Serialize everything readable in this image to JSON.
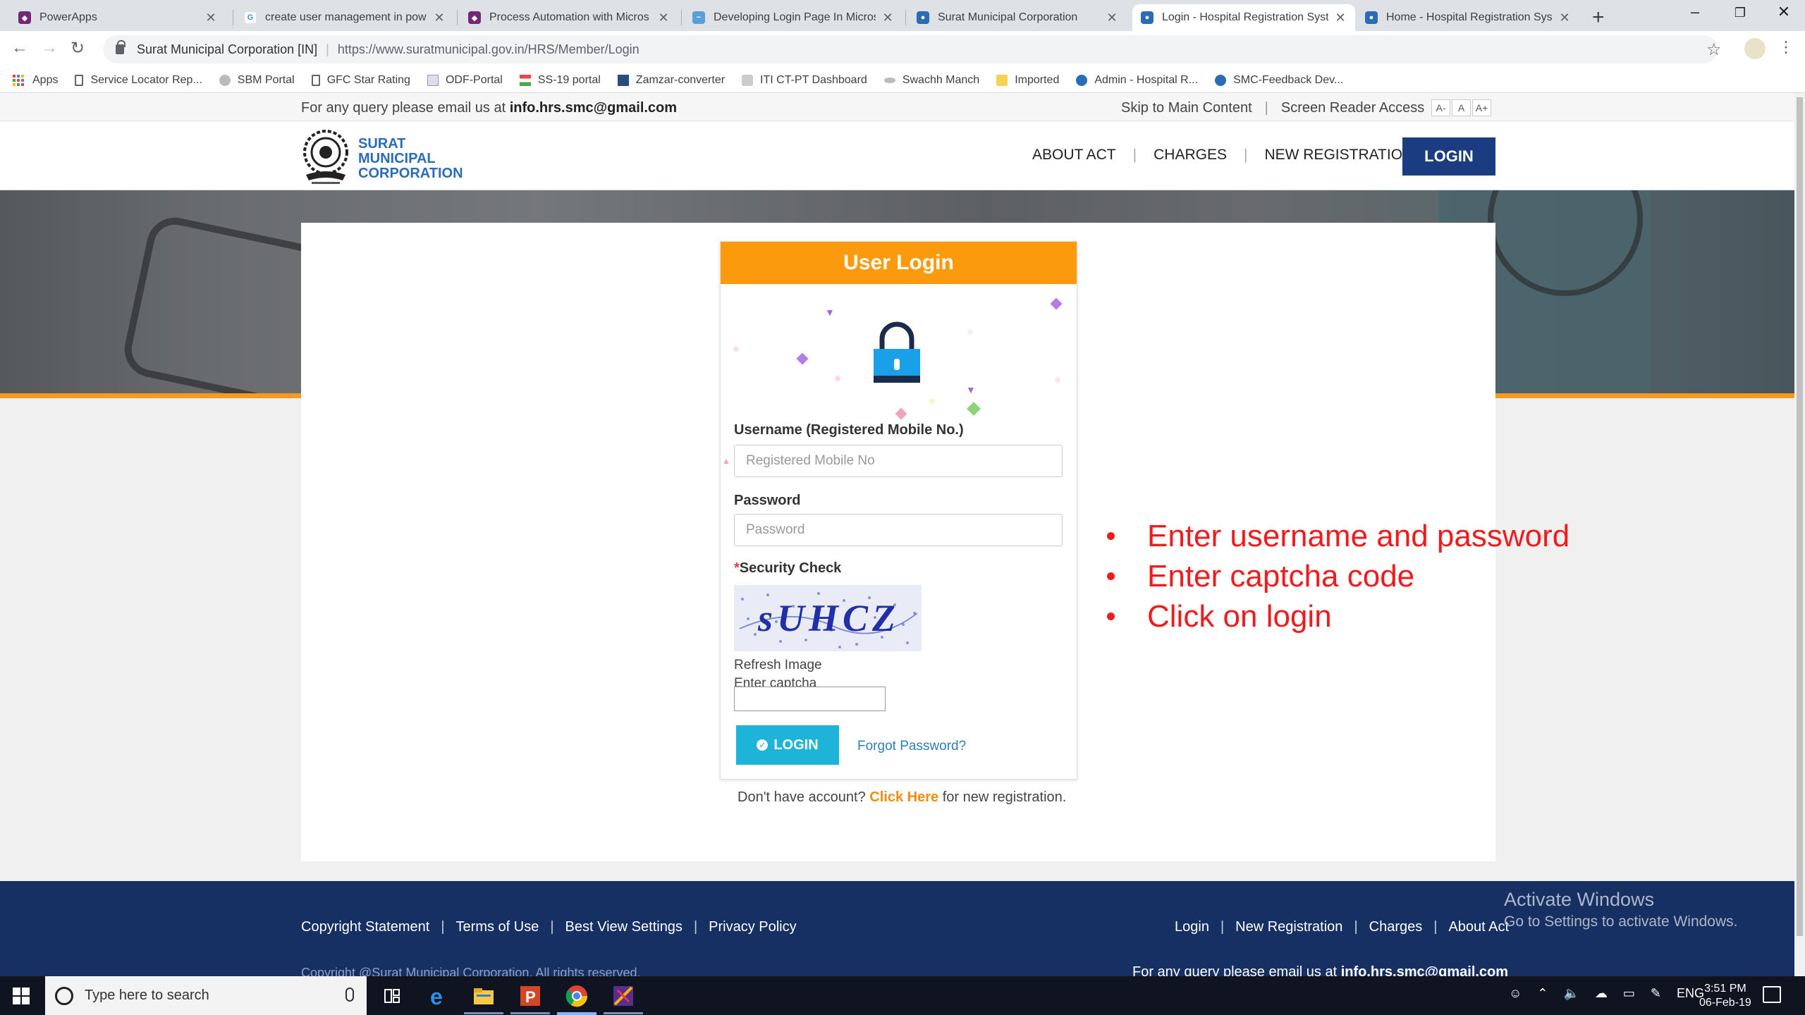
{
  "browser": {
    "tabs": [
      {
        "title": "PowerApps",
        "favicon_color": "#742774"
      },
      {
        "title": "create user management in pow",
        "favicon_color": "#4285f4"
      },
      {
        "title": "Process Automation with Micros",
        "favicon_color": "#742774"
      },
      {
        "title": "Developing Login Page In Micros",
        "favicon_color": "#5aa0d8"
      },
      {
        "title": "Surat Municipal Corporation",
        "favicon_color": "#2b6cb8"
      },
      {
        "title": "Login - Hospital Registration Syst",
        "favicon_color": "#2b6cb8",
        "active": true
      },
      {
        "title": "Home - Hospital Registration Sys",
        "favicon_color": "#2b6cb8"
      }
    ],
    "new_tab": "+",
    "window_controls": [
      "–",
      "❐",
      "✕"
    ],
    "omnibox": {
      "site": "Surat Municipal Corporation [IN]",
      "url": "https://www.suratmunicipal.gov.in/HRS/Member/Login"
    },
    "bookmarks": [
      {
        "label": "Apps",
        "icon": "apps-grid-icon"
      },
      {
        "label": "Service Locator Rep...",
        "icon": "page-icon"
      },
      {
        "label": "SBM Portal",
        "icon": "sbm-icon"
      },
      {
        "label": "GFC Star Rating",
        "icon": "page-icon"
      },
      {
        "label": "ODF-Portal",
        "icon": "odf-icon"
      },
      {
        "label": "SS-19 portal",
        "icon": "ss19-icon"
      },
      {
        "label": "Zamzar-converter",
        "icon": "zamzar-icon"
      },
      {
        "label": "ITI CT-PT Dashboard",
        "icon": "iti-icon"
      },
      {
        "label": "Swachh Manch",
        "icon": "swachh-icon"
      },
      {
        "label": "Imported",
        "icon": "folder-icon"
      },
      {
        "label": "Admin - Hospital R...",
        "icon": "smc-icon"
      },
      {
        "label": "SMC-Feedback Dev...",
        "icon": "smc-icon"
      }
    ]
  },
  "topbar": {
    "query_prefix": "For any query please email us at",
    "email": "info.hrs.smc@gmail.com",
    "skip": "Skip to Main Content",
    "divider": "|",
    "screen_reader": "Screen Reader Access",
    "font_sizes": [
      "A-",
      "A",
      "A+"
    ]
  },
  "header": {
    "logo_lines": [
      "SURAT",
      "MUNICIPAL",
      "CORPORATION"
    ],
    "nav": [
      "ABOUT ACT",
      "CHARGES",
      "NEW REGISTRATION"
    ],
    "nav_sep": "|",
    "login": "LOGIN"
  },
  "login_card": {
    "title": "User Login",
    "username_label": "Username (Registered Mobile No.)",
    "username_placeholder": "Registered Mobile No",
    "password_label": "Password",
    "password_placeholder": "Password",
    "security_required_mark": "*",
    "security_label": "Security Check",
    "captcha_text": "sUHCZ",
    "refresh_image": "Refresh Image",
    "enter_captcha": "Enter captcha",
    "login_button": "LOGIN",
    "forgot": "Forgot Password?",
    "register_prefix": "Don't have account?",
    "register_link": "Click Here",
    "register_suffix": "for new registration."
  },
  "annotations": [
    "Enter username and password",
    "Enter captcha code",
    "Click on login"
  ],
  "footer": {
    "left_links": [
      "Copyright Statement",
      "Terms of Use",
      "Best View Settings",
      "Privacy Policy"
    ],
    "right_links": [
      "Login",
      "New Registration",
      "Charges",
      "About Act"
    ],
    "sep": "|",
    "copyright": "Copyright @Surat Municipal Corporation. All rights reserved.",
    "query_prefix": "For any query please email us at",
    "email": "info.hrs.smc@gmail.com"
  },
  "watermark": {
    "line1": "Activate Windows",
    "line2": "Go to Settings to activate Windows."
  },
  "taskbar": {
    "search_placeholder": "Type here to search",
    "language": "ENG",
    "time": "3:51 PM",
    "date": "06-Feb-19"
  },
  "colors": {
    "brand_blue": "#2b6cb8",
    "nav_login_bg": "#1b3c80",
    "card_header": "#fc9a0d",
    "login_button": "#1eb3d8",
    "annotation_red": "#ee1c1c",
    "footer_bg": "#163064"
  }
}
